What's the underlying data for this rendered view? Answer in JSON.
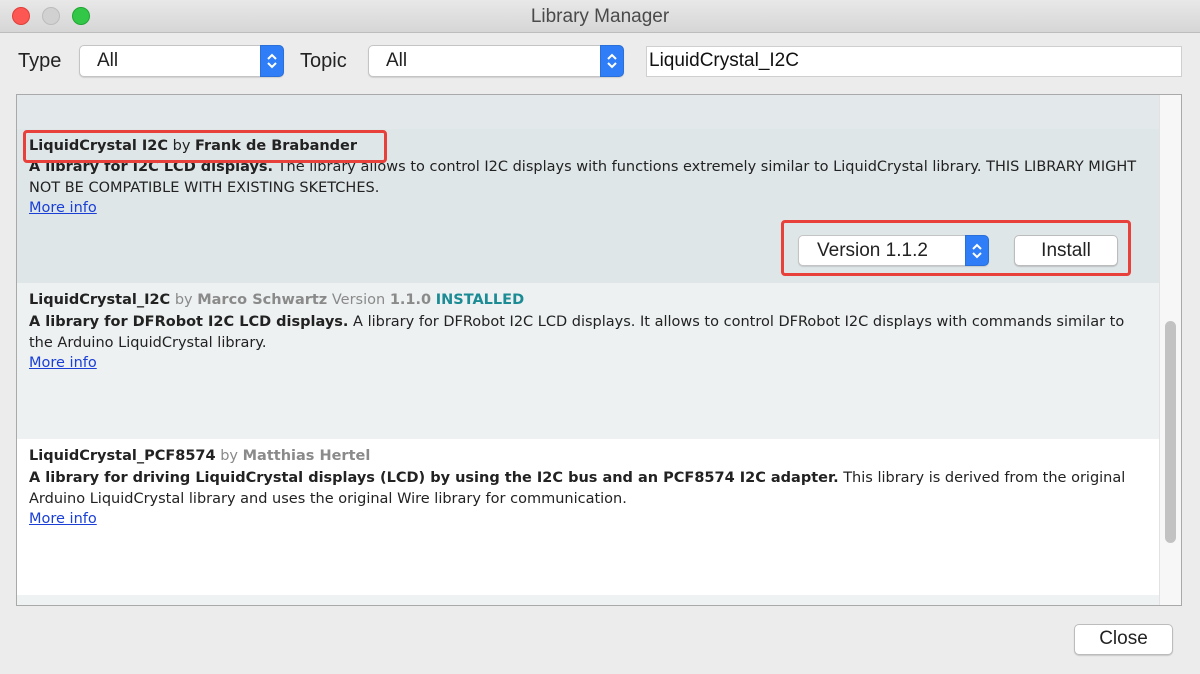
{
  "window": {
    "title": "Library Manager"
  },
  "filters": {
    "type_label": "Type",
    "type_value": "All",
    "topic_label": "Topic",
    "topic_value": "All",
    "search_value": "LiquidCrystal_I2C"
  },
  "libraries": [
    {
      "name": "LiquidCrystal I2C",
      "by": "by",
      "author": "Frank de Brabander",
      "summary": "A library for I2C LCD displays.",
      "description": "The library allows to control I2C displays with functions extremely similar to LiquidCrystal library. THIS LIBRARY MIGHT NOT BE COMPATIBLE WITH EXISTING SKETCHES.",
      "more_info": "More info",
      "version_select": "Version 1.1.2",
      "install_label": "Install"
    },
    {
      "name": "LiquidCrystal_I2C",
      "by": "by",
      "author": "Marco Schwartz",
      "version_word": "Version",
      "version": "1.1.0",
      "status": "INSTALLED",
      "summary": "A library for DFRobot I2C LCD displays.",
      "description": "A library for DFRobot I2C LCD displays. It allows to control DFRobot I2C displays with commands similar to the Arduino LiquidCrystal library.",
      "more_info": "More info"
    },
    {
      "name": "LiquidCrystal_PCF8574",
      "by": "by",
      "author": "Matthias Hertel",
      "summary": "A library for driving LiquidCrystal displays (LCD) by using the I2C bus and an PCF8574 I2C adapter.",
      "description": "This library is derived from the original Arduino LiquidCrystal library and uses the original Wire library for communication.",
      "more_info": "More info"
    }
  ],
  "footer": {
    "close_label": "Close"
  },
  "colors": {
    "highlight": "#e8403a",
    "installed": "#1b8b94",
    "link": "#1a3fd6",
    "stepper": "#2f7ef7"
  }
}
